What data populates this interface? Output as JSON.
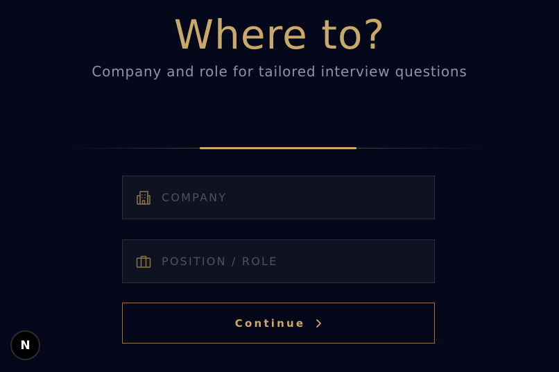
{
  "header": {
    "title": "Where to?",
    "subtitle": "Company and role for tailored interview questions"
  },
  "progress": {
    "fraction": 0.38
  },
  "form": {
    "company": {
      "placeholder": "COMPANY",
      "value": "",
      "icon": "building-icon"
    },
    "position": {
      "placeholder": "POSITION / ROLE",
      "value": "",
      "icon": "briefcase-icon"
    },
    "continue_label": "Continue",
    "continue_icon": "chevron-right-icon"
  },
  "badge": {
    "label": "N"
  },
  "colors": {
    "background": "#05071a",
    "accent": "#c9a96a",
    "field_bg": "#0f121f",
    "subtitle": "#8e93a8"
  }
}
